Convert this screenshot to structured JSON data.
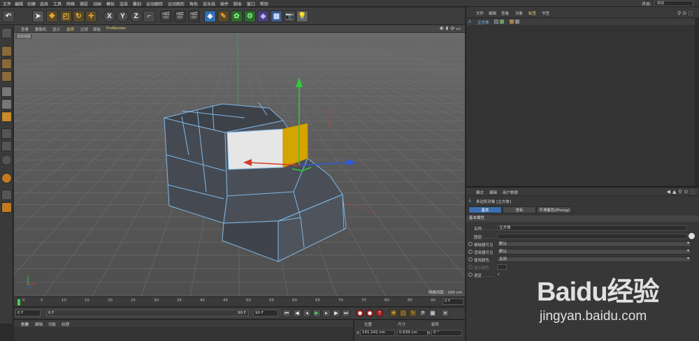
{
  "menubar": {
    "items": [
      "文件",
      "编辑",
      "创建",
      "选择",
      "工具",
      "网格",
      "捕捉",
      "动画",
      "模拟",
      "渲染",
      "雕刻",
      "运动跟踪",
      "运动图形",
      "角色",
      "流水线",
      "插件",
      "脚本",
      "窗口",
      "帮助"
    ],
    "layout_label": "界面:",
    "layout_value": "启动"
  },
  "toolbar": {
    "axis_x": "X",
    "axis_y": "Y",
    "axis_z": "Z"
  },
  "viewport": {
    "menu": [
      "查看",
      "摄像机",
      "显示",
      "选项",
      "过滤",
      "面板",
      "ProRender"
    ],
    "label": "透视视图",
    "grid_spacing": "网格间距 : 100 cm"
  },
  "timeline": {
    "ticks": [
      "0",
      "5",
      "10",
      "15",
      "20",
      "25",
      "30",
      "35",
      "40",
      "45",
      "50",
      "55",
      "60",
      "65",
      "70",
      "75",
      "80",
      "85",
      "90"
    ],
    "end_frame": "0 F"
  },
  "transport": {
    "current_frame": "0 F",
    "start_frame": "0 F",
    "range_end": "90 F",
    "end_frame": "90 F"
  },
  "material_bar": {
    "items": [
      "创建",
      "编辑",
      "功能",
      "纹理"
    ]
  },
  "coordinates": {
    "headers": [
      "位置",
      "尺寸",
      "旋转"
    ],
    "x_label": "X",
    "x_position": "141.241 cm",
    "x_size": "0.639 cm",
    "h_label": "H",
    "h_rotation": "0 °"
  },
  "object_manager": {
    "menu": [
      "文件",
      "编辑",
      "查看",
      "对象",
      "标签",
      "书签"
    ],
    "object_name": "立方体"
  },
  "attributes": {
    "menu": [
      "模式",
      "编辑",
      "用户数据"
    ],
    "object_title": "多边形对象 [立方体]",
    "tabs": [
      "基本",
      "坐标",
      "平滑着色(Phong)"
    ],
    "section": "基本属性",
    "rows": [
      {
        "label": "名称 . . . . .",
        "value": "立方体"
      },
      {
        "label": "图层 . . . . .",
        "value": ""
      },
      {
        "label": "编辑器可见",
        "value": "默认"
      },
      {
        "label": "渲染器可见",
        "value": "默认"
      },
      {
        "label": "使用颜色 . .",
        "value": "关闭"
      },
      {
        "label": "显示颜色 . . .",
        "value": ""
      },
      {
        "label": "透显 . . . . .",
        "value": "✓"
      }
    ]
  },
  "watermark": {
    "logo": "Baidu经验",
    "url": "jingyan.baidu.com"
  },
  "colors": {
    "accent_blue": "#3d6fb0",
    "timeline_marker": "#3fd14a",
    "axis_x": "#d23a2a",
    "axis_y": "#2ecc3a",
    "axis_z": "#2a5bd8",
    "selected_face": "#d4a400"
  }
}
